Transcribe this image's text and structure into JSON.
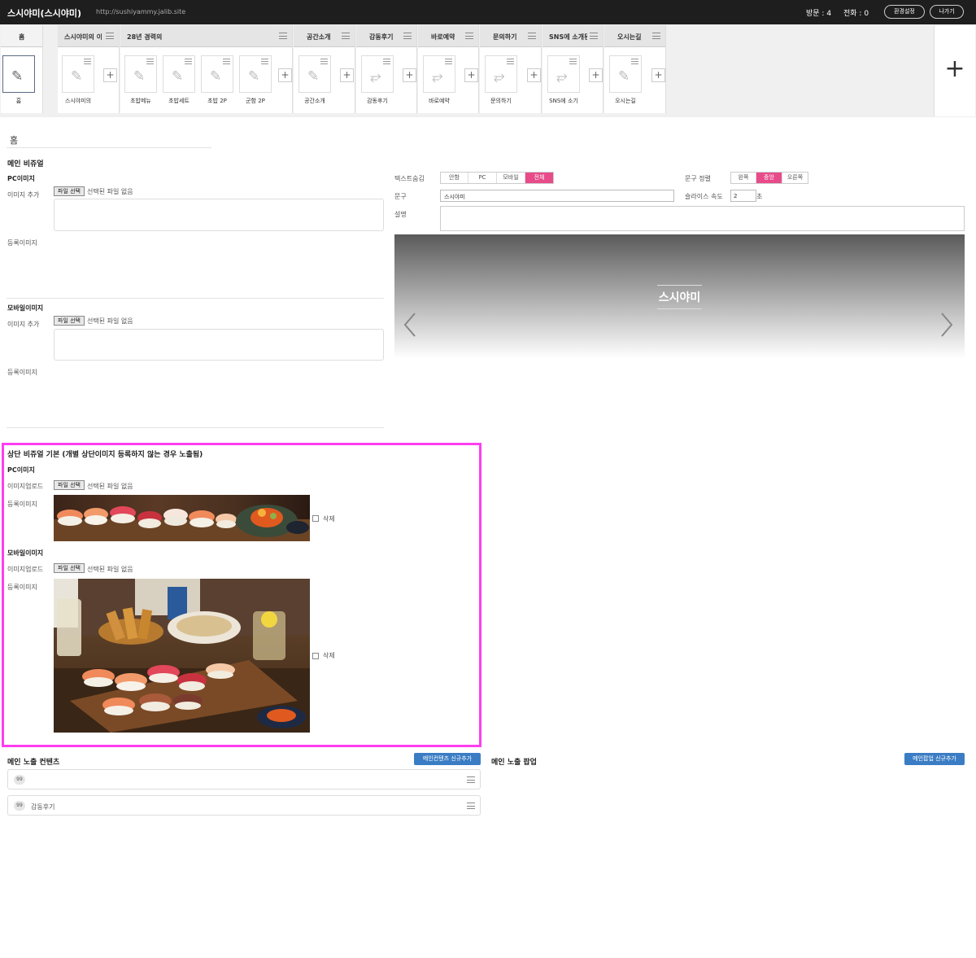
{
  "header": {
    "title": "스시야미(스시야미)",
    "url": "http://sushiyammy.jalib.site",
    "visits": "방문 : 4",
    "calls": "전화 : 0",
    "settings_label": "환경설정",
    "logout_label": "나가기"
  },
  "tabs": [
    {
      "label": "홈",
      "items": [
        "홈"
      ]
    },
    {
      "label": "스시야미의 이",
      "items": [
        "스시야미의"
      ]
    },
    {
      "label": "28년 경력의",
      "items": [
        "초밥메뉴",
        "초밥세트",
        "초밥 2P",
        "군함 2P"
      ]
    },
    {
      "label": "공간소개",
      "items": [
        "공간소개"
      ]
    },
    {
      "label": "감동후기",
      "items": [
        "감동후기"
      ]
    },
    {
      "label": "바로예약",
      "items": [
        "바로예약"
      ]
    },
    {
      "label": "문의하기",
      "items": [
        "문의하기"
      ]
    },
    {
      "label": "SNS에 소개된",
      "items": [
        "SNS에 소기"
      ]
    },
    {
      "label": "오시는길",
      "items": [
        "오시는길"
      ]
    }
  ],
  "page_title": "홈",
  "main_visual": {
    "heading": "메인 비쥬얼",
    "pc_label": "PC이미지",
    "mobile_label": "모바일이미지",
    "add_image": "이미지 추가",
    "file_button": "파일 선택",
    "no_file": "선택된 파일 없음",
    "registered": "등록이미지"
  },
  "text_settings": {
    "hide_label": "텍스트숨김",
    "hide_options": [
      "안함",
      "PC",
      "모바일",
      "전체"
    ],
    "hide_selected": "전체",
    "phrase_label": "문구",
    "phrase_value": "스시야미",
    "align_label": "문구 정렬",
    "align_options": [
      "왼쪽",
      "중앙",
      "오른쪽"
    ],
    "align_selected": "중앙",
    "speed_label": "슬라이스 속도",
    "speed_value": "2",
    "speed_unit": "초",
    "desc_label": "설명"
  },
  "preview": {
    "text": "스시야미"
  },
  "top_visual": {
    "heading": "상단 비쥬얼 기본 (개별 상단이미지 등록하지 않는 경우 노출됨)",
    "pc_label": "PC이미지",
    "mobile_label": "모바일이미지",
    "upload": "이미지업로드",
    "file_button": "파일 선택",
    "no_file": "선택된 파일 없음",
    "registered": "등록이미지",
    "delete": "삭제"
  },
  "main_contents": {
    "heading": "메인 노출 컨텐츠",
    "add_label": "메인컨텐츠 신규추가",
    "rows": [
      {
        "order": "99",
        "name": ""
      },
      {
        "order": "99",
        "name": "감동후기"
      }
    ]
  },
  "main_popup": {
    "heading": "메인 노출 팝업",
    "add_label": "메인팝업 신규추가"
  },
  "colors": {
    "accent": "#e84b8a",
    "highlight_border": "#ff3ef0",
    "button_blue": "#3b7dc4",
    "topbar": "#1e1e1e"
  }
}
